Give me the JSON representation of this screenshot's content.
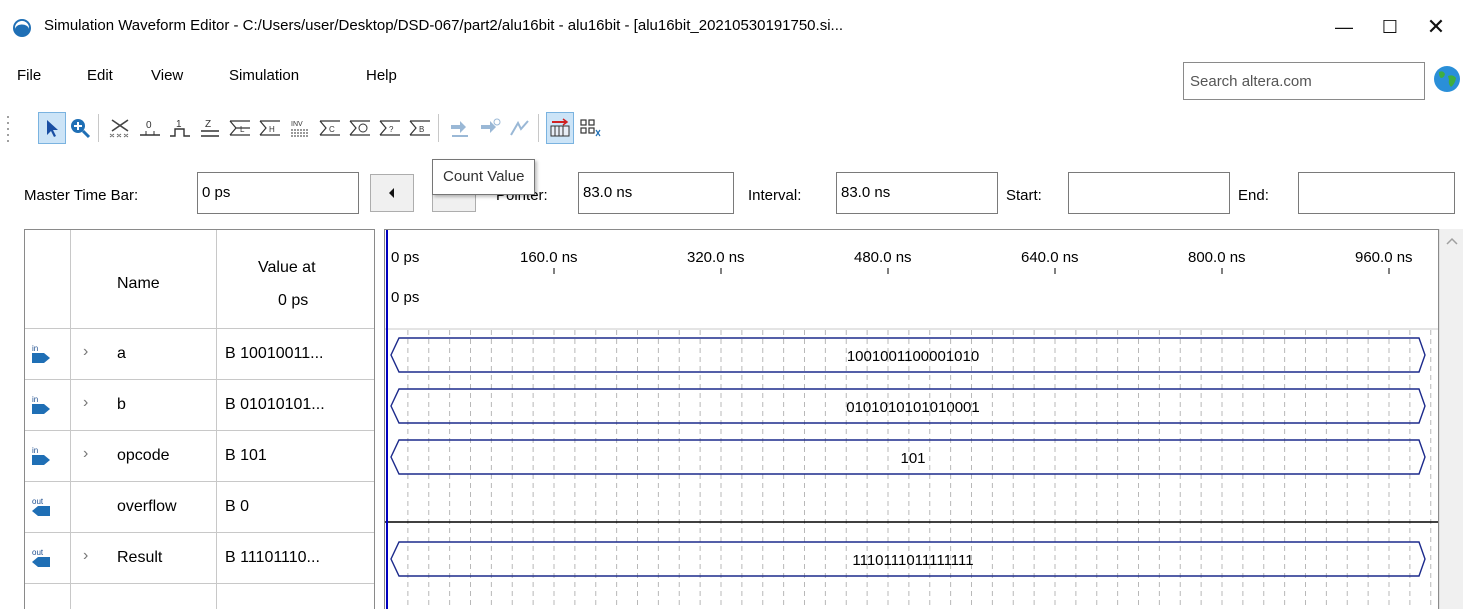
{
  "window": {
    "title": "Simulation Waveform Editor - C:/Users/user/Desktop/DSD-067/part2/alu16bit - alu16bit - [alu16bit_20210530191750.si...",
    "minimize": "—",
    "maximize": "☐",
    "close": "✕"
  },
  "menu": {
    "items": [
      "File",
      "Edit",
      "View",
      "Simulation",
      "Help"
    ],
    "search_placeholder": "Search altera.com"
  },
  "toolbar": {
    "icons": [
      "selection-tool-icon",
      "zoom-tool-icon",
      "force-unknown-icon",
      "force-low-icon",
      "force-high-icon",
      "force-high-impedance-icon",
      "force-weak-low-icon",
      "force-weak-high-icon",
      "invert-icon",
      "count-value-icon",
      "overwrite-clock-icon",
      "random-values-icon",
      "arbitrary-value-icon",
      "run-functional-simulation-icon",
      "run-timing-simulation-icon",
      "generate-netlist-icon",
      "snap-to-grid-icon",
      "grid-settings-icon"
    ],
    "tooltip": "Count Value"
  },
  "timebar": {
    "master_label": "Master Time Bar:",
    "master_value": "0 ps",
    "pointer_label": "Pointer:",
    "pointer_value": "83.0 ns",
    "interval_label": "Interval:",
    "interval_value": "83.0 ns",
    "start_label": "Start:",
    "start_value": "",
    "end_label": "End:",
    "end_value": ""
  },
  "table": {
    "header_name": "Name",
    "header_value_line1": "Value at",
    "header_value_line2": "0 ps",
    "signals": [
      {
        "name": "a",
        "direction": "in",
        "expandable": true,
        "value": "B 10010011...",
        "wave": "1001001100001010"
      },
      {
        "name": "b",
        "direction": "in",
        "expandable": true,
        "value": "B 01010101...",
        "wave": "0101010101010001"
      },
      {
        "name": "opcode",
        "direction": "in",
        "expandable": true,
        "value": "B 101",
        "wave": "101"
      },
      {
        "name": "overflow",
        "direction": "out",
        "expandable": false,
        "value": "B 0",
        "wave": ""
      },
      {
        "name": "Result",
        "direction": "out",
        "expandable": true,
        "value": "B 11101110...",
        "wave": "1110111011111111"
      }
    ]
  },
  "timeline": {
    "ticks": [
      "0 ps",
      "160.0 ns",
      "320.0 ns",
      "480.0 ns",
      "640.0 ns",
      "800.0 ns",
      "960.0 ns"
    ],
    "cursor_label": "0 ps"
  },
  "colors": {
    "cursor": "#0000c0",
    "bus_outline": "#1c2a8c",
    "grid": "#b8b8b8",
    "in_icon": "#1f6fb5",
    "tooltip_border": "#767676"
  }
}
